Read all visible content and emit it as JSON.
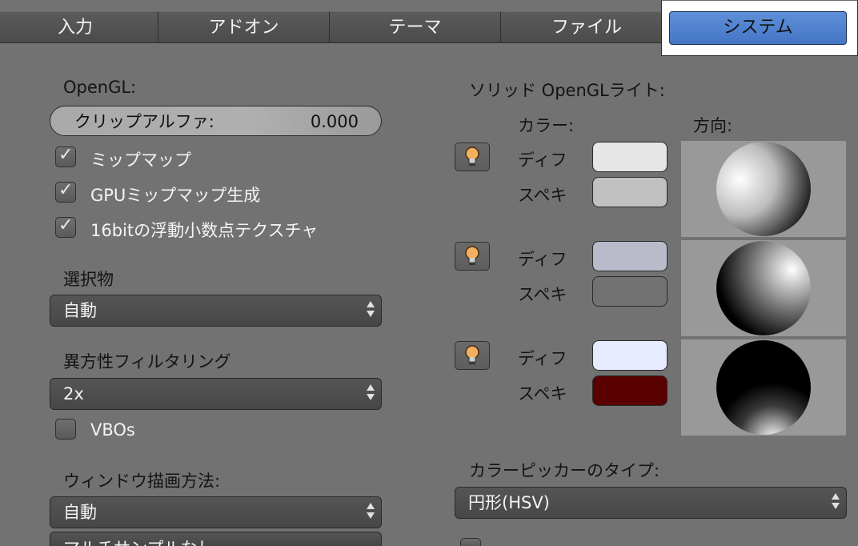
{
  "tabs": [
    {
      "label": "入力"
    },
    {
      "label": "アドオン"
    },
    {
      "label": "テーマ"
    },
    {
      "label": "ファイル"
    },
    {
      "label": "システム",
      "active": true
    }
  ],
  "left": {
    "opengl_label": "OpenGL:",
    "clip_alpha": {
      "label": "クリップアルファ:",
      "value": "0.000"
    },
    "checkboxes": [
      {
        "label": "ミップマップ",
        "checked": true
      },
      {
        "label": "GPUミップマップ生成",
        "checked": true
      },
      {
        "label": "16bitの浮動小数点テクスチャ",
        "checked": true
      }
    ],
    "selection_label": "選択物",
    "selection_value": "自動",
    "anisotropic_label": "異方性フィルタリング",
    "anisotropic_value": "2x",
    "vbos": {
      "label": "VBOs",
      "checked": false
    },
    "window_draw_label": "ウィンドウ描画方法:",
    "window_draw_value": "自動",
    "multisample_value": "マルチサンプルなし"
  },
  "right": {
    "solid_lights_label": "ソリッド OpenGLライト:",
    "color_header": "カラー:",
    "direction_header": "方向:",
    "lights": [
      {
        "diffuse_label": "ディフ",
        "specular_label": "スペキ",
        "diffuse_color": "#e6e6e6",
        "specular_color": "#c0c0c0"
      },
      {
        "diffuse_label": "ディフ",
        "specular_label": "スペキ",
        "diffuse_color": "#b9bbcb",
        "specular_color": "#727272"
      },
      {
        "diffuse_label": "ディフ",
        "specular_label": "スペキ",
        "diffuse_color": "#e6ebff",
        "specular_color": "#5a0000"
      }
    ],
    "picker_label": "カラーピッカーのタイプ:",
    "picker_value": "円形(HSV)"
  },
  "colors": {
    "active_tab": "#5282d0",
    "background": "#727272"
  }
}
